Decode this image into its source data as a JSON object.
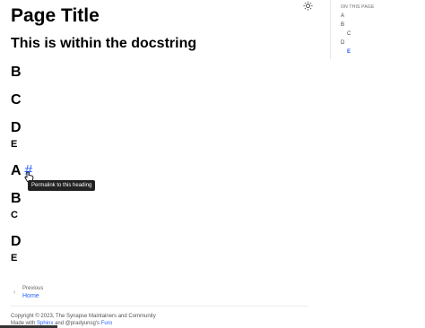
{
  "main": {
    "page_title": "Page Title",
    "docstring_heading": "This is within the docstring",
    "sections": [
      "B",
      "C",
      "D",
      "E",
      "A",
      "B",
      "C",
      "D",
      "E"
    ],
    "permalink_symbol": "#",
    "permalink_tooltip": "Permalink to this heading"
  },
  "toc": {
    "title": "ON THIS PAGE",
    "items": [
      "A",
      "B",
      "C",
      "D",
      "E"
    ]
  },
  "nav": {
    "prev_label": "Previous",
    "prev_title": "Home"
  },
  "footer": {
    "copyright": "Copyright © 2023, The Synapse Maintainers and Community",
    "made_with": "Made with",
    "sphinx": "Sphinx",
    "and": "and",
    "author": "@pradyunsg's",
    "furo": "Furo"
  },
  "icons": {
    "theme": "sun-icon",
    "cursor": "hand-pointer-icon",
    "chevron": "chevron-left-icon"
  },
  "colors": {
    "link": "#2962ff",
    "tooltip_bg": "#222222"
  }
}
